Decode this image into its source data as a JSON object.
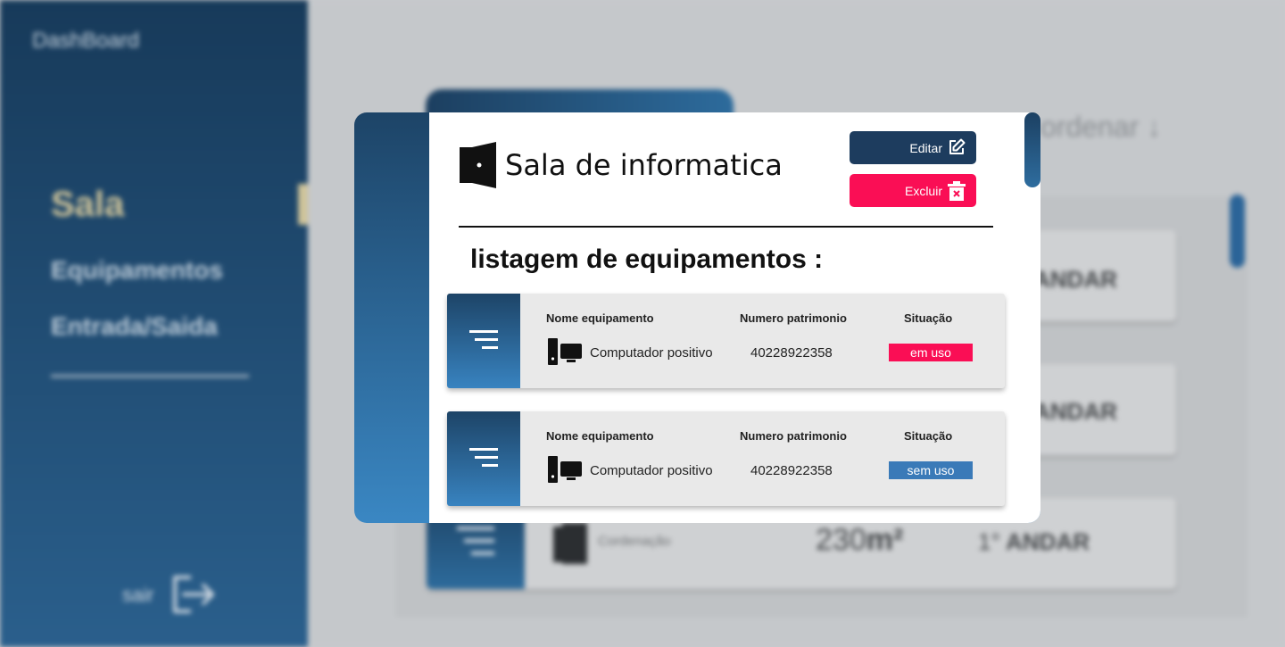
{
  "sidebar": {
    "title": "DashBoard",
    "items": [
      {
        "label": "Sala"
      },
      {
        "label": "Equipamentos"
      },
      {
        "label": "Entrada/Saida"
      }
    ],
    "logout_label": "sair"
  },
  "background": {
    "sort_label": "ordenar",
    "rows": [
      {
        "floor_text": "ANDAR"
      },
      {
        "floor_text": "ANDAR"
      },
      {
        "name": "Cordenação",
        "area_value": "230",
        "area_unit": "m²",
        "floor_num": "1°",
        "floor_text": "ANDAR"
      }
    ]
  },
  "modal": {
    "room_title": "Sala de informatica",
    "edit_label": "Editar",
    "delete_label": "Excluir",
    "list_heading": "listagem de equipamentos :",
    "columns": {
      "name": "Nome equipamento",
      "number": "Numero patrimonio",
      "status": "Situação"
    },
    "equipment": [
      {
        "name": "Computador positivo",
        "number": "40228922358",
        "status": "em uso",
        "status_color": "#fa0e55"
      },
      {
        "name": "Computador positivo",
        "number": "40228922358",
        "status": "sem uso",
        "status_color": "#3a7ab8"
      }
    ]
  },
  "colors": {
    "primary_dark": "#1d3c5e",
    "accent_blue": "#3883c0",
    "danger": "#fa0e55"
  }
}
